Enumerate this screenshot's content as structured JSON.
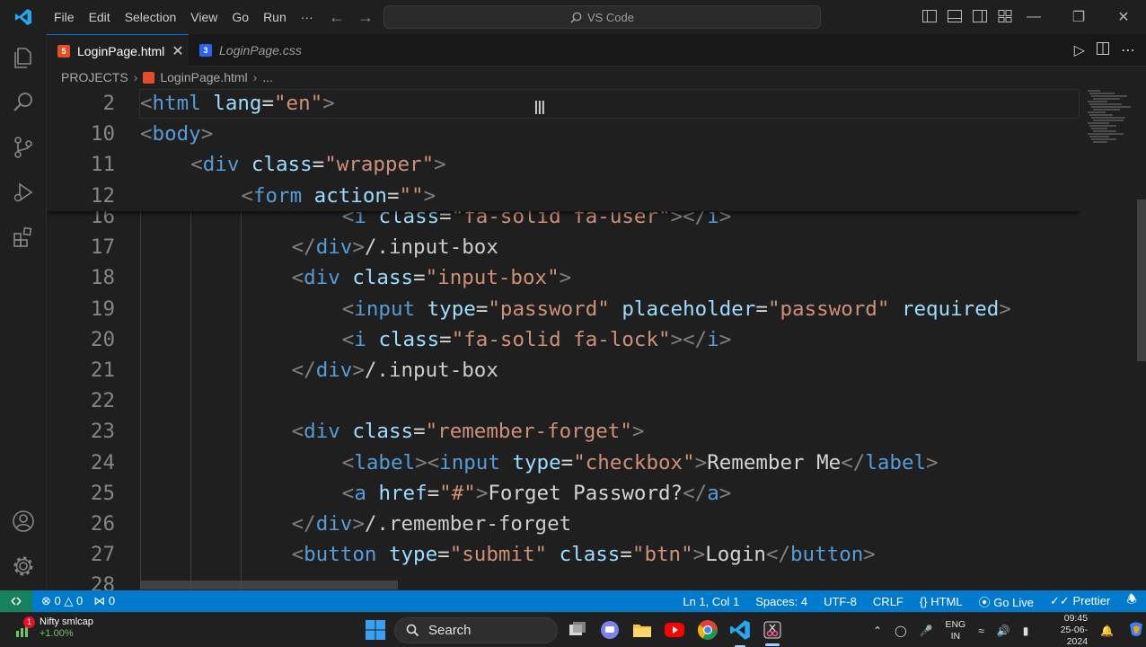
{
  "menu": [
    "File",
    "Edit",
    "Selection",
    "View",
    "Go",
    "Run",
    "···"
  ],
  "search_box": {
    "text": "VS Code"
  },
  "tabs": [
    {
      "label": "LoginPage.html",
      "type": "html",
      "active": true
    },
    {
      "label": "LoginPage.css",
      "type": "css",
      "active": false
    }
  ],
  "breadcrumb": {
    "root": "PROJECTS",
    "file": "LoginPage.html",
    "tail": "..."
  },
  "sticky_lines": [
    {
      "num": "2",
      "indent": 0,
      "tokens": [
        [
          "tg",
          "<"
        ],
        [
          "tn",
          "html"
        ],
        [
          "tx",
          " "
        ],
        [
          "an",
          "lang"
        ],
        [
          "tx",
          "="
        ],
        [
          "av",
          "\"en\""
        ],
        [
          "tg",
          ">"
        ]
      ]
    },
    {
      "num": "10",
      "indent": 0,
      "tokens": [
        [
          "tg",
          "<"
        ],
        [
          "tn",
          "body"
        ],
        [
          "tg",
          ">"
        ]
      ]
    },
    {
      "num": "11",
      "indent": 1,
      "tokens": [
        [
          "tg",
          "<"
        ],
        [
          "tn",
          "div"
        ],
        [
          "tx",
          " "
        ],
        [
          "an",
          "class"
        ],
        [
          "tx",
          "="
        ],
        [
          "av",
          "\"wrapper\""
        ],
        [
          "tg",
          ">"
        ]
      ]
    },
    {
      "num": "12",
      "indent": 2,
      "tokens": [
        [
          "tg",
          "<"
        ],
        [
          "tn",
          "form"
        ],
        [
          "tx",
          " "
        ],
        [
          "an",
          "action"
        ],
        [
          "tx",
          "="
        ],
        [
          "av",
          "\"\""
        ],
        [
          "tg",
          ">"
        ]
      ]
    }
  ],
  "code_lines": [
    {
      "num": "16",
      "indent": 4,
      "tokens": [
        [
          "tg",
          "<"
        ],
        [
          "tn",
          "i"
        ],
        [
          "tx",
          " "
        ],
        [
          "an",
          "class"
        ],
        [
          "tx",
          "="
        ],
        [
          "av",
          "\"fa-solid fa-user\""
        ],
        [
          "tg",
          "></"
        ],
        [
          "tn",
          "i"
        ],
        [
          "tg",
          ">"
        ]
      ]
    },
    {
      "num": "17",
      "indent": 3,
      "tokens": [
        [
          "tg",
          "</"
        ],
        [
          "tn",
          "div"
        ],
        [
          "tg",
          ">"
        ],
        [
          "cm",
          "/.input-box"
        ]
      ]
    },
    {
      "num": "18",
      "indent": 3,
      "tokens": [
        [
          "tg",
          "<"
        ],
        [
          "tn",
          "div"
        ],
        [
          "tx",
          " "
        ],
        [
          "an",
          "class"
        ],
        [
          "tx",
          "="
        ],
        [
          "av",
          "\"input-box\""
        ],
        [
          "tg",
          ">"
        ]
      ]
    },
    {
      "num": "19",
      "indent": 4,
      "tokens": [
        [
          "tg",
          "<"
        ],
        [
          "tn",
          "input"
        ],
        [
          "tx",
          " "
        ],
        [
          "an",
          "type"
        ],
        [
          "tx",
          "="
        ],
        [
          "av",
          "\"password\""
        ],
        [
          "tx",
          " "
        ],
        [
          "an",
          "placeholder"
        ],
        [
          "tx",
          "="
        ],
        [
          "av",
          "\"password\""
        ],
        [
          "tx",
          " "
        ],
        [
          "an",
          "required"
        ],
        [
          "tg",
          ">"
        ]
      ]
    },
    {
      "num": "20",
      "indent": 4,
      "tokens": [
        [
          "tg",
          "<"
        ],
        [
          "tn",
          "i"
        ],
        [
          "tx",
          " "
        ],
        [
          "an",
          "class"
        ],
        [
          "tx",
          "="
        ],
        [
          "av",
          "\"fa-solid fa-lock\""
        ],
        [
          "tg",
          "></"
        ],
        [
          "tn",
          "i"
        ],
        [
          "tg",
          ">"
        ]
      ]
    },
    {
      "num": "21",
      "indent": 3,
      "tokens": [
        [
          "tg",
          "</"
        ],
        [
          "tn",
          "div"
        ],
        [
          "tg",
          ">"
        ],
        [
          "cm",
          "/.input-box"
        ]
      ]
    },
    {
      "num": "22",
      "indent": 0,
      "tokens": []
    },
    {
      "num": "23",
      "indent": 3,
      "tokens": [
        [
          "tg",
          "<"
        ],
        [
          "tn",
          "div"
        ],
        [
          "tx",
          " "
        ],
        [
          "an",
          "class"
        ],
        [
          "tx",
          "="
        ],
        [
          "av",
          "\"remember-forget\""
        ],
        [
          "tg",
          ">"
        ]
      ]
    },
    {
      "num": "24",
      "indent": 4,
      "tokens": [
        [
          "tg",
          "<"
        ],
        [
          "tn",
          "label"
        ],
        [
          "tg",
          "><"
        ],
        [
          "tn",
          "input"
        ],
        [
          "tx",
          " "
        ],
        [
          "an",
          "type"
        ],
        [
          "tx",
          "="
        ],
        [
          "av",
          "\"checkbox\""
        ],
        [
          "tg",
          ">"
        ],
        [
          "tx",
          "Remember Me"
        ],
        [
          "tg",
          "</"
        ],
        [
          "tn",
          "label"
        ],
        [
          "tg",
          ">"
        ]
      ]
    },
    {
      "num": "25",
      "indent": 4,
      "tokens": [
        [
          "tg",
          "<"
        ],
        [
          "tn",
          "a"
        ],
        [
          "tx",
          " "
        ],
        [
          "an",
          "href"
        ],
        [
          "tx",
          "="
        ],
        [
          "av",
          "\"#\""
        ],
        [
          "tg",
          ">"
        ],
        [
          "tx",
          "Forget Password?"
        ],
        [
          "tg",
          "</"
        ],
        [
          "tn",
          "a"
        ],
        [
          "tg",
          ">"
        ]
      ]
    },
    {
      "num": "26",
      "indent": 3,
      "tokens": [
        [
          "tg",
          "</"
        ],
        [
          "tn",
          "div"
        ],
        [
          "tg",
          ">"
        ],
        [
          "cm",
          "/.remember-forget"
        ]
      ]
    },
    {
      "num": "27",
      "indent": 3,
      "tokens": [
        [
          "tg",
          "<"
        ],
        [
          "tn",
          "button"
        ],
        [
          "tx",
          " "
        ],
        [
          "an",
          "type"
        ],
        [
          "tx",
          "="
        ],
        [
          "av",
          "\"submit\""
        ],
        [
          "tx",
          " "
        ],
        [
          "an",
          "class"
        ],
        [
          "tx",
          "="
        ],
        [
          "av",
          "\"btn\""
        ],
        [
          "tg",
          ">"
        ],
        [
          "tx",
          "Login"
        ],
        [
          "tg",
          "</"
        ],
        [
          "tn",
          "button"
        ],
        [
          "tg",
          ">"
        ]
      ]
    },
    {
      "num": "28",
      "indent": 0,
      "tokens": []
    }
  ],
  "status": {
    "errors": "0",
    "warnings": "0",
    "ports": "0",
    "position": "Ln 1, Col 1",
    "spaces": "Spaces: 4",
    "encoding": "UTF-8",
    "eol": "CRLF",
    "language": "HTML",
    "golive": "Go Live",
    "prettier": "Prettier"
  },
  "taskbar": {
    "widget_title": "Nifty smlcap",
    "widget_change": "+1.00%",
    "widget_badge": "1",
    "search": "Search",
    "lang_top": "ENG",
    "lang_bottom": "IN",
    "time": "09:45",
    "date": "25-06-2024"
  },
  "colors": {
    "accent": "#007acc",
    "tag": "#569cd6",
    "attr": "#9cdcfe",
    "string": "#ce9178",
    "bracket": "#808080"
  }
}
